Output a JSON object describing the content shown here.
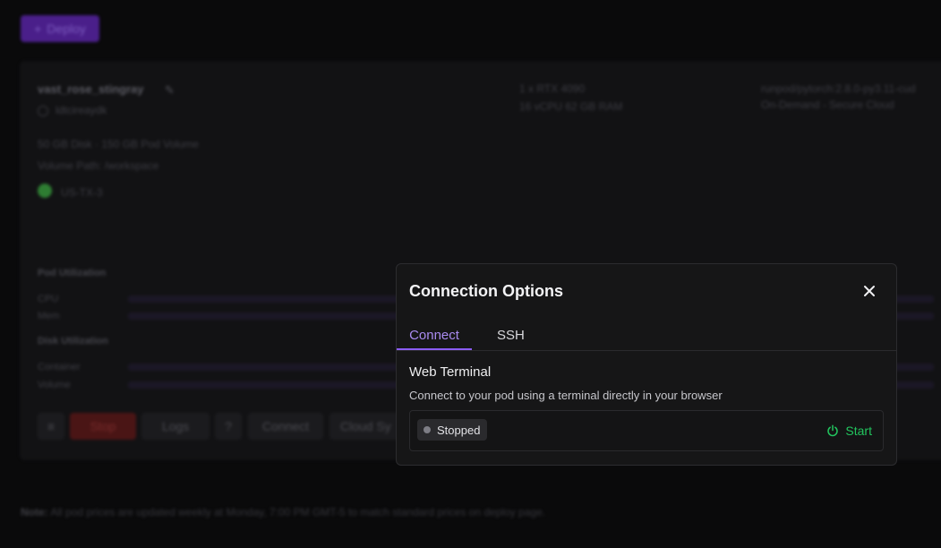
{
  "background": {
    "deploy_label": "Deploy",
    "pod": {
      "name": "vast_rose_stingray",
      "id": "ldtcireaydk",
      "storage": "50 GB Disk · 150 GB Pod Volume",
      "volume_path": "Volume Path: /workspace",
      "region": "US-TX-3",
      "gpu": "1 x RTX 4090",
      "specs": "16 vCPU 62 GB RAM",
      "image": "runpod/pytorch:2.8.0-py3.11-cud",
      "cloud": "On-Demand - Secure Cloud"
    },
    "pod_utilization_title": "Pod Utilization",
    "cpu_label": "CPU",
    "mem_label": "Mem",
    "disk_utilization_title": "Disk Utilization",
    "container_label": "Container",
    "volume_label": "Volume",
    "actions": {
      "stop": "Stop",
      "logs": "Logs",
      "connect": "Connect",
      "cloud_sync": "Cloud Sy"
    },
    "note_prefix": "Note:",
    "note_text": "All pod prices are updated weekly at Monday, 7:00 PM GMT-5 to match standard prices on deploy page."
  },
  "modal": {
    "title": "Connection Options",
    "tabs": [
      {
        "label": "Connect",
        "active": true
      },
      {
        "label": "SSH",
        "active": false
      }
    ],
    "web_terminal": {
      "heading": "Web Terminal",
      "description": "Connect to your pod using a terminal directly in your browser",
      "status": "Stopped",
      "start_label": "Start"
    }
  },
  "colors": {
    "accent": "#8b5cf6",
    "start_green": "#22c55e",
    "stop_red": "#4a1515"
  },
  "icons": [
    "close-icon",
    "power-icon",
    "pencil-icon",
    "globe-icon"
  ]
}
